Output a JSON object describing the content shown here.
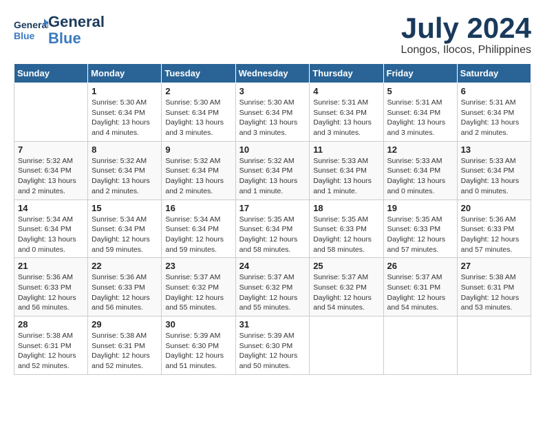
{
  "logo": {
    "line1": "General",
    "line2": "Blue"
  },
  "title": "July 2024",
  "location": "Longos, Ilocos, Philippines",
  "days_header": [
    "Sunday",
    "Monday",
    "Tuesday",
    "Wednesday",
    "Thursday",
    "Friday",
    "Saturday"
  ],
  "weeks": [
    [
      {
        "day": "",
        "info": ""
      },
      {
        "day": "1",
        "info": "Sunrise: 5:30 AM\nSunset: 6:34 PM\nDaylight: 13 hours\nand 4 minutes."
      },
      {
        "day": "2",
        "info": "Sunrise: 5:30 AM\nSunset: 6:34 PM\nDaylight: 13 hours\nand 3 minutes."
      },
      {
        "day": "3",
        "info": "Sunrise: 5:30 AM\nSunset: 6:34 PM\nDaylight: 13 hours\nand 3 minutes."
      },
      {
        "day": "4",
        "info": "Sunrise: 5:31 AM\nSunset: 6:34 PM\nDaylight: 13 hours\nand 3 minutes."
      },
      {
        "day": "5",
        "info": "Sunrise: 5:31 AM\nSunset: 6:34 PM\nDaylight: 13 hours\nand 3 minutes."
      },
      {
        "day": "6",
        "info": "Sunrise: 5:31 AM\nSunset: 6:34 PM\nDaylight: 13 hours\nand 2 minutes."
      }
    ],
    [
      {
        "day": "7",
        "info": "Sunrise: 5:32 AM\nSunset: 6:34 PM\nDaylight: 13 hours\nand 2 minutes."
      },
      {
        "day": "8",
        "info": "Sunrise: 5:32 AM\nSunset: 6:34 PM\nDaylight: 13 hours\nand 2 minutes."
      },
      {
        "day": "9",
        "info": "Sunrise: 5:32 AM\nSunset: 6:34 PM\nDaylight: 13 hours\nand 2 minutes."
      },
      {
        "day": "10",
        "info": "Sunrise: 5:32 AM\nSunset: 6:34 PM\nDaylight: 13 hours\nand 1 minute."
      },
      {
        "day": "11",
        "info": "Sunrise: 5:33 AM\nSunset: 6:34 PM\nDaylight: 13 hours\nand 1 minute."
      },
      {
        "day": "12",
        "info": "Sunrise: 5:33 AM\nSunset: 6:34 PM\nDaylight: 13 hours\nand 0 minutes."
      },
      {
        "day": "13",
        "info": "Sunrise: 5:33 AM\nSunset: 6:34 PM\nDaylight: 13 hours\nand 0 minutes."
      }
    ],
    [
      {
        "day": "14",
        "info": "Sunrise: 5:34 AM\nSunset: 6:34 PM\nDaylight: 13 hours\nand 0 minutes."
      },
      {
        "day": "15",
        "info": "Sunrise: 5:34 AM\nSunset: 6:34 PM\nDaylight: 12 hours\nand 59 minutes."
      },
      {
        "day": "16",
        "info": "Sunrise: 5:34 AM\nSunset: 6:34 PM\nDaylight: 12 hours\nand 59 minutes."
      },
      {
        "day": "17",
        "info": "Sunrise: 5:35 AM\nSunset: 6:34 PM\nDaylight: 12 hours\nand 58 minutes."
      },
      {
        "day": "18",
        "info": "Sunrise: 5:35 AM\nSunset: 6:33 PM\nDaylight: 12 hours\nand 58 minutes."
      },
      {
        "day": "19",
        "info": "Sunrise: 5:35 AM\nSunset: 6:33 PM\nDaylight: 12 hours\nand 57 minutes."
      },
      {
        "day": "20",
        "info": "Sunrise: 5:36 AM\nSunset: 6:33 PM\nDaylight: 12 hours\nand 57 minutes."
      }
    ],
    [
      {
        "day": "21",
        "info": "Sunrise: 5:36 AM\nSunset: 6:33 PM\nDaylight: 12 hours\nand 56 minutes."
      },
      {
        "day": "22",
        "info": "Sunrise: 5:36 AM\nSunset: 6:33 PM\nDaylight: 12 hours\nand 56 minutes."
      },
      {
        "day": "23",
        "info": "Sunrise: 5:37 AM\nSunset: 6:32 PM\nDaylight: 12 hours\nand 55 minutes."
      },
      {
        "day": "24",
        "info": "Sunrise: 5:37 AM\nSunset: 6:32 PM\nDaylight: 12 hours\nand 55 minutes."
      },
      {
        "day": "25",
        "info": "Sunrise: 5:37 AM\nSunset: 6:32 PM\nDaylight: 12 hours\nand 54 minutes."
      },
      {
        "day": "26",
        "info": "Sunrise: 5:37 AM\nSunset: 6:31 PM\nDaylight: 12 hours\nand 54 minutes."
      },
      {
        "day": "27",
        "info": "Sunrise: 5:38 AM\nSunset: 6:31 PM\nDaylight: 12 hours\nand 53 minutes."
      }
    ],
    [
      {
        "day": "28",
        "info": "Sunrise: 5:38 AM\nSunset: 6:31 PM\nDaylight: 12 hours\nand 52 minutes."
      },
      {
        "day": "29",
        "info": "Sunrise: 5:38 AM\nSunset: 6:31 PM\nDaylight: 12 hours\nand 52 minutes."
      },
      {
        "day": "30",
        "info": "Sunrise: 5:39 AM\nSunset: 6:30 PM\nDaylight: 12 hours\nand 51 minutes."
      },
      {
        "day": "31",
        "info": "Sunrise: 5:39 AM\nSunset: 6:30 PM\nDaylight: 12 hours\nand 50 minutes."
      },
      {
        "day": "",
        "info": ""
      },
      {
        "day": "",
        "info": ""
      },
      {
        "day": "",
        "info": ""
      }
    ]
  ]
}
